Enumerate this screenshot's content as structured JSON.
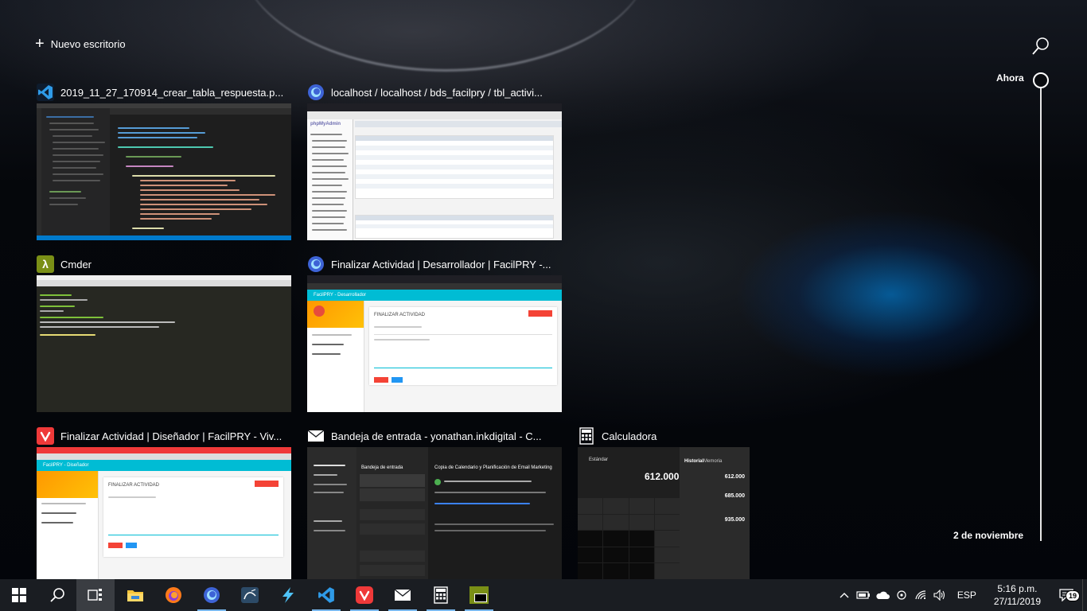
{
  "top_bar": {
    "new_desktop_label": "Nuevo escritorio",
    "search_icon": "search-icon"
  },
  "timeline": {
    "now_label": "Ahora",
    "date_label": "2 de noviembre"
  },
  "windows": [
    {
      "title": "2019_11_27_170914_crear_tabla_respuesta.p...",
      "app": "Visual Studio Code",
      "icon": "vscode-icon",
      "accent": "#0078d4"
    },
    {
      "title": "localhost / localhost / bds_facilpry / tbl_activi...",
      "app": "Firefox Developer Edition",
      "icon": "firefox-dev-icon",
      "accent": "#3b6fe8",
      "thumb_heading": "phpMyAdmin"
    },
    {
      "title": "Cmder",
      "app": "Cmder",
      "icon": "cmder-icon",
      "accent": "#8a9a1c"
    },
    {
      "title": "Finalizar Actividad | Desarrollador | FacilPRY -...",
      "app": "Firefox Developer Edition",
      "icon": "firefox-dev-icon",
      "accent": "#00bcd4",
      "thumb_header": "FacilPRY - Desarrollador",
      "thumb_heading": "FINALIZAR ACTIVIDAD"
    },
    {
      "title": "Finalizar Actividad | Diseñador | FacilPRY - Viv...",
      "app": "Vivaldi",
      "icon": "vivaldi-icon",
      "accent": "#ef3939",
      "thumb_header": "FacilPRY - Diseñador",
      "thumb_heading": "FINALIZAR ACTIVIDAD"
    },
    {
      "title": "Bandeja de entrada - yonathan.inkdigital - C...",
      "app": "Correo",
      "icon": "mail-icon",
      "accent": "#ffffff",
      "thumb_heading": "Bandeja de entrada",
      "thumb_subject": "Copia de Calendario y Planificación de Email Marketing"
    },
    {
      "title": "Calculadora",
      "app": "Calculadora",
      "icon": "calculator-icon",
      "accent": "#ffffff",
      "thumb_mode": "Estándar",
      "thumb_display": "612.000",
      "thumb_history_tab": "Historial",
      "thumb_memory_tab": "Memoria",
      "thumb_history_values": [
        "612.000",
        "685.000",
        "935.000"
      ]
    }
  ],
  "taskbar": {
    "start": "windows-icon",
    "search": "search-icon",
    "task_view": "task-view-icon",
    "apps": [
      {
        "name": "file-explorer-icon",
        "active": false
      },
      {
        "name": "firefox-icon",
        "active": false
      },
      {
        "name": "firefox-dev-icon",
        "active": true
      },
      {
        "name": "mysql-workbench-icon",
        "active": false
      },
      {
        "name": "lightning-icon",
        "active": false
      },
      {
        "name": "vscode-icon",
        "active": true
      },
      {
        "name": "vivaldi-icon",
        "active": true
      },
      {
        "name": "mail-icon",
        "active": true
      },
      {
        "name": "calculator-icon",
        "active": true
      },
      {
        "name": "cmder-icon",
        "active": true
      }
    ],
    "tray": {
      "language": "ESP",
      "time": "5:16 p.m.",
      "date": "27/11/2019",
      "notification_count": "19"
    }
  }
}
